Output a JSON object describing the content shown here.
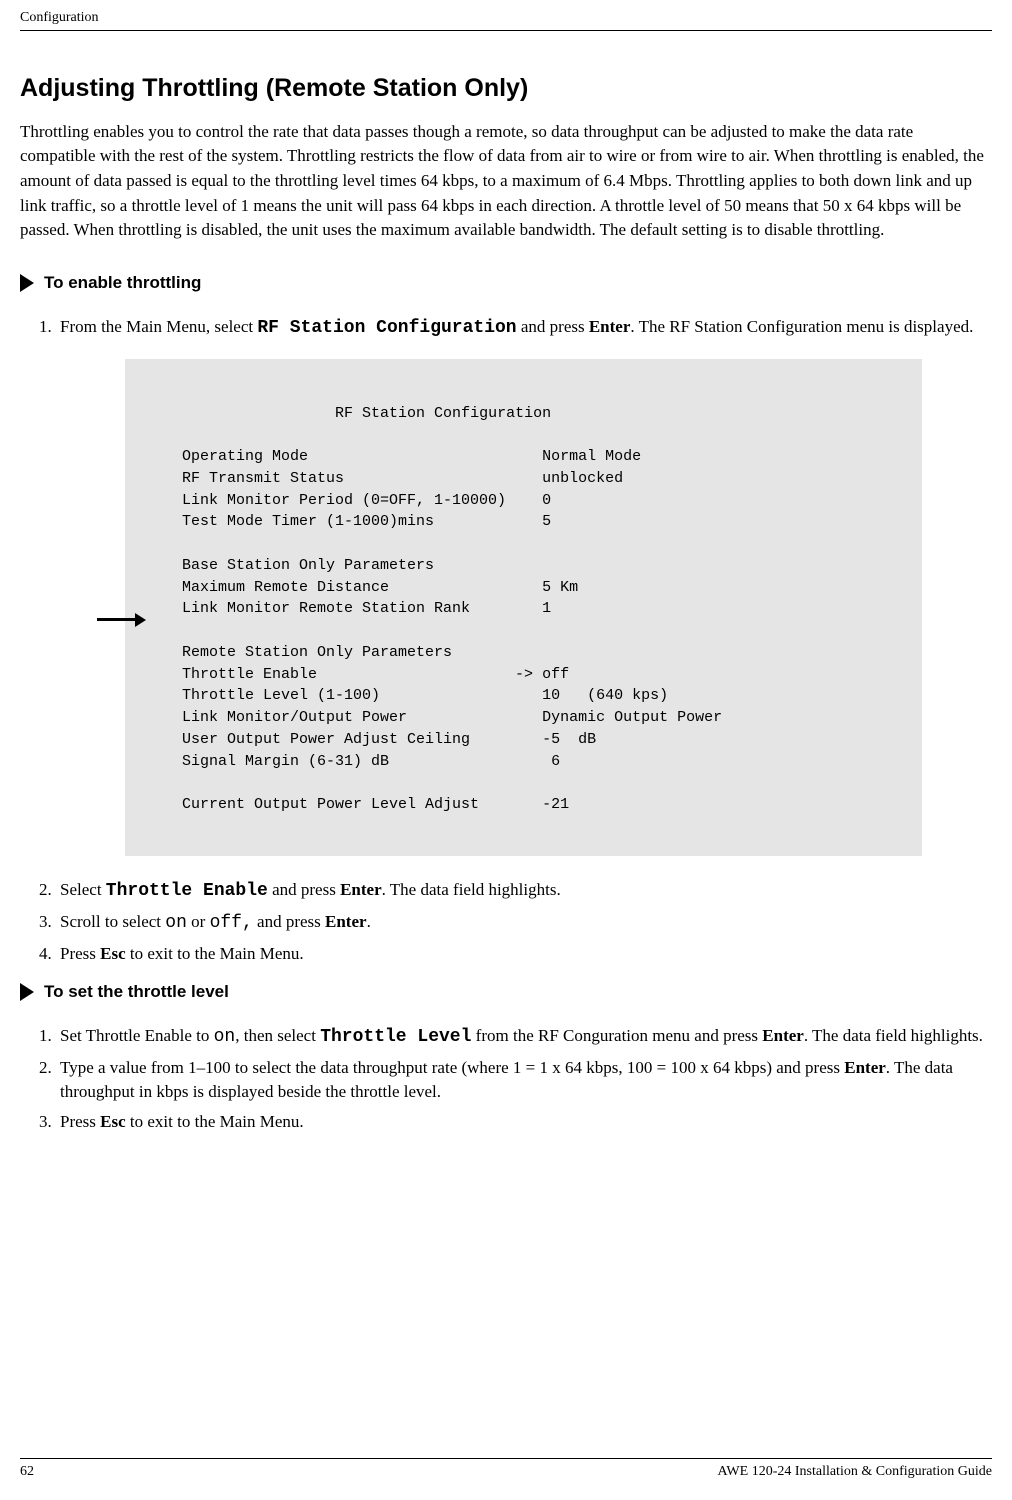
{
  "header": "Configuration",
  "title": "Adjusting Throttling (Remote Station Only)",
  "intro": "Throttling enables you to control the rate that data passes though a remote, so data throughput can be adjusted to make the data rate compatible with the rest of the system. Throttling restricts the flow of data from air to wire or from wire to air. When throttling is enabled, the amount of data passed is equal to the throttling level times 64 kbps, to a maximum of 6.4 Mbps. Throttling applies to both down link and up link traffic, so a throttle level of 1 means the unit will pass 64 kbps in each direction. A throttle level of 50 means that 50 x 64 kbps will be passed. When throttling is disabled, the unit uses the maximum available bandwidth. The default setting is to disable throttling.",
  "section1": {
    "title": "To enable throttling",
    "step1_a": "From the Main Menu, select ",
    "step1_cmd": "RF Station Configuration",
    "step1_b": " and press ",
    "step1_key": "Enter",
    "step1_c": ". The RF Station Configuration menu is displayed.",
    "step2_a": "Select ",
    "step2_cmd": "Throttle Enable",
    "step2_b": " and press ",
    "step2_key": "Enter",
    "step2_c": ". The data field highlights.",
    "step3_a": "Scroll to select ",
    "step3_on": "on",
    "step3_or": " or ",
    "step3_off": "off,",
    "step3_b": " and press ",
    "step3_key": "Enter",
    "step3_c": ".",
    "step4_a": "Press ",
    "step4_key": "Esc",
    "step4_b": " to exit to the Main Menu."
  },
  "config_display": "                  RF Station Configuration\n\n   Operating Mode                          Normal Mode\n   RF Transmit Status                      unblocked\n   Link Monitor Period (0=OFF, 1-10000)    0\n   Test Mode Timer (1-1000)mins            5\n\n   Base Station Only Parameters\n   Maximum Remote Distance                 5 Km\n   Link Monitor Remote Station Rank        1\n\n   Remote Station Only Parameters\n   Throttle Enable                      -> off\n   Throttle Level (1-100)                  10   (640 kps)\n   Link Monitor/Output Power               Dynamic Output Power\n   User Output Power Adjust Ceiling        -5  dB\n   Signal Margin (6-31) dB                  6\n\n   Current Output Power Level Adjust       -21",
  "section2": {
    "title": "To set the throttle level",
    "step1_a": "Set Throttle Enable to ",
    "step1_on": "on",
    "step1_b": ", then select ",
    "step1_cmd": "Throttle Level",
    "step1_c": " from the RF Conguration menu and press ",
    "step1_key": "Enter",
    "step1_d": ". The data field highlights.",
    "step2_a": "Type a value from 1–100 to select the data throughput rate (where 1 = 1 x 64 kbps, 100 = 100 x 64 kbps) and press ",
    "step2_key": "Enter",
    "step2_b": ". The data throughput in kbps is displayed beside the throttle level.",
    "step3_a": "Press ",
    "step3_key": "Esc",
    "step3_b": " to exit to the Main Menu."
  },
  "footer": {
    "page": "62",
    "doc": "AWE 120-24 Installation & Configuration Guide"
  }
}
